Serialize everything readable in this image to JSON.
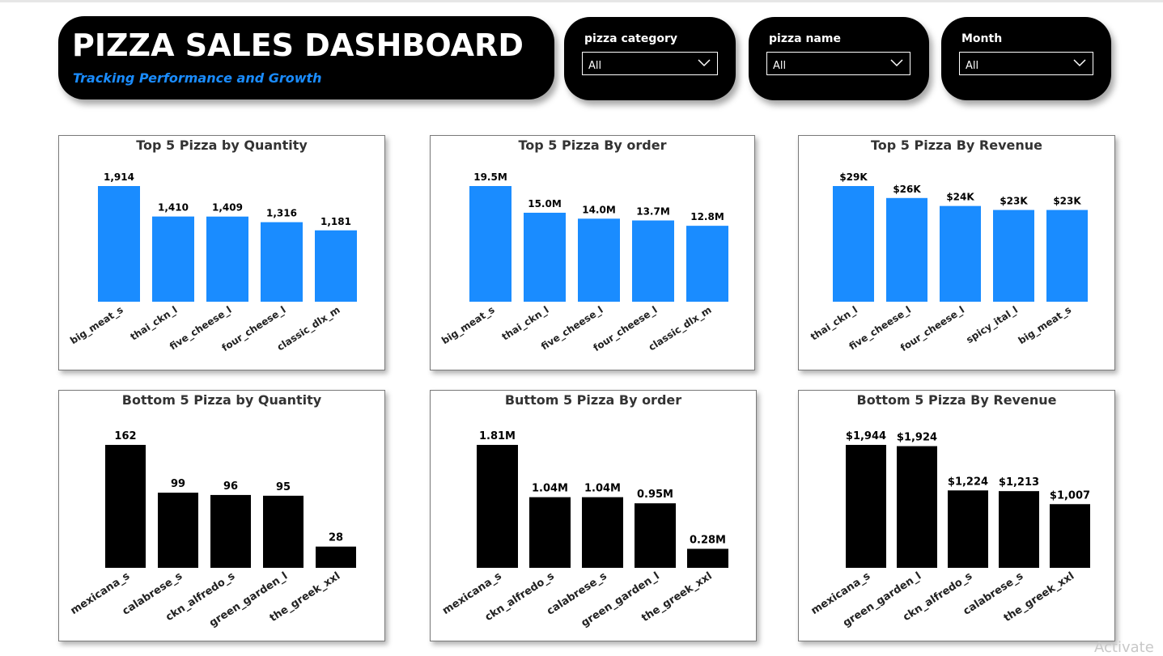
{
  "header": {
    "title": "PIZZA SALES DASHBOARD",
    "subtitle": "Tracking Performance and Growth"
  },
  "filters": [
    {
      "label": "pizza category",
      "value": "All"
    },
    {
      "label": "pizza name",
      "value": "All"
    },
    {
      "label": "Month",
      "value": "All"
    }
  ],
  "colors": {
    "top_bar": "#1a8cff",
    "bottom_bar": "#000000",
    "card_bg": "#000000",
    "subtitle": "#1a8cff"
  },
  "watermark": "Activate",
  "chart_data": [
    {
      "type": "bar",
      "title": "Top 5 Pizza by Quantity",
      "categories": [
        "big_meat_s",
        "thai_ckn_l",
        "five_cheese_l",
        "four_cheese_l",
        "classic_dlx_m"
      ],
      "values": [
        1914,
        1410,
        1409,
        1316,
        1181
      ],
      "data_labels": [
        "1,914",
        "1,410",
        "1,409",
        "1,316",
        "1,181"
      ]
    },
    {
      "type": "bar",
      "title": "Top 5 Pizza By order",
      "categories": [
        "big_meat_s",
        "thai_ckn_l",
        "five_cheese_l",
        "four_cheese_l",
        "classic_dlx_m"
      ],
      "values": [
        19.5,
        15.0,
        14.0,
        13.7,
        12.8
      ],
      "data_labels": [
        "19.5M",
        "15.0M",
        "14.0M",
        "13.7M",
        "12.8M"
      ]
    },
    {
      "type": "bar",
      "title": "Top 5 Pizza By Revenue",
      "categories": [
        "thai_ckn_l",
        "five_cheese_l",
        "four_cheese_l",
        "spicy_ital_l",
        "big_meat_s"
      ],
      "values": [
        29,
        26,
        24,
        23,
        23
      ],
      "data_labels": [
        "$29K",
        "$26K",
        "$24K",
        "$23K",
        "$23K"
      ]
    },
    {
      "type": "bar",
      "title": "Bottom 5 Pizza by Quantity",
      "categories": [
        "mexicana_s",
        "calabrese_s",
        "ckn_alfredo_s",
        "green_garden_l",
        "the_greek_xxl"
      ],
      "values": [
        162,
        99,
        96,
        95,
        28
      ],
      "data_labels": [
        "162",
        "99",
        "96",
        "95",
        "28"
      ]
    },
    {
      "type": "bar",
      "title": "Buttom 5 Pizza By order",
      "categories": [
        "mexicana_s",
        "ckn_alfredo_s",
        "calabrese_s",
        "green_garden_l",
        "the_greek_xxl"
      ],
      "values": [
        1.81,
        1.04,
        1.04,
        0.95,
        0.28
      ],
      "data_labels": [
        "1.81M",
        "1.04M",
        "1.04M",
        "0.95M",
        "0.28M"
      ]
    },
    {
      "type": "bar",
      "title": "Bottom 5 Pizza By Revenue",
      "categories": [
        "mexicana_s",
        "green_garden_l",
        "ckn_alfredo_s",
        "calabrese_s",
        "the_greek_xxl"
      ],
      "values": [
        1944,
        1924,
        1224,
        1213,
        1007
      ],
      "data_labels": [
        "$1,944",
        "$1,924",
        "$1,224",
        "$1,213",
        "$1,007"
      ]
    }
  ]
}
